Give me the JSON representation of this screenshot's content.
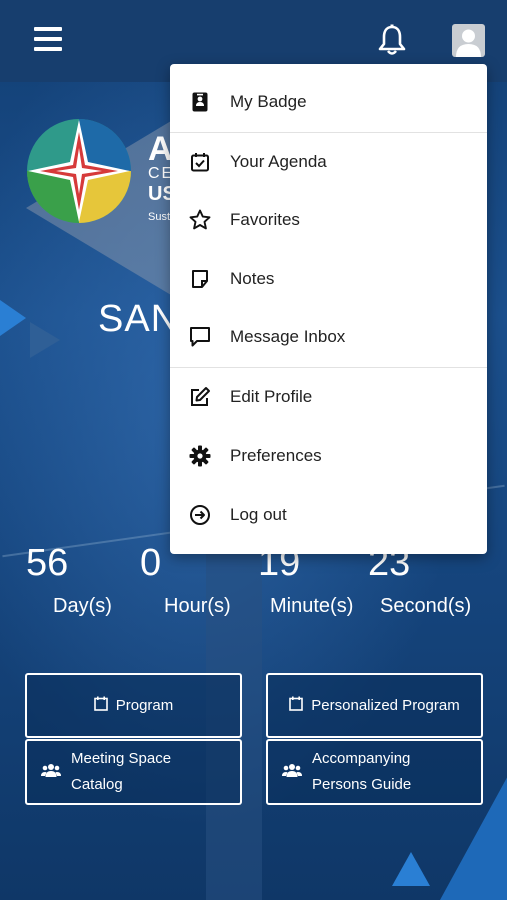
{
  "topbar": {
    "menu_icon": "hamburger-icon",
    "notifications_icon": "bell-icon",
    "profile_icon": "avatar-icon"
  },
  "hero": {
    "conference_letters_1": "A",
    "conference_letters_2": "CE",
    "conference_letters_3": "US",
    "conference_letters_4": "Sust",
    "city": "SAN"
  },
  "countdown": {
    "days": {
      "value": "56",
      "label": "Day(s)"
    },
    "hours": {
      "value": "0",
      "label": "Hour(s)"
    },
    "minutes": {
      "value": "19",
      "label": "Minute(s)"
    },
    "seconds": {
      "value": "23",
      "label": "Second(s)"
    }
  },
  "tiles": {
    "program": "Program",
    "personalized_program": "Personalized Program",
    "meeting_space_line1": "Meeting Space",
    "meeting_space_line2": "Catalog",
    "accompanying_line1": "Accompanying",
    "accompanying_line2": "Persons Guide"
  },
  "menu": {
    "items": [
      {
        "label": "My Badge",
        "icon": "badge-icon"
      },
      {
        "label": "Your Agenda",
        "icon": "calendar-check-icon"
      },
      {
        "label": "Favorites",
        "icon": "star-icon"
      },
      {
        "label": "Notes",
        "icon": "note-icon"
      },
      {
        "label": "Message Inbox",
        "icon": "message-icon"
      },
      {
        "label": "Edit Profile",
        "icon": "edit-icon"
      },
      {
        "label": "Preferences",
        "icon": "gear-icon"
      },
      {
        "label": "Log out",
        "icon": "logout-icon"
      }
    ]
  },
  "colors": {
    "topbar": "#173e6e",
    "background": "#1b4f8c",
    "menu_bg": "#ffffff",
    "menu_text": "#222222"
  }
}
